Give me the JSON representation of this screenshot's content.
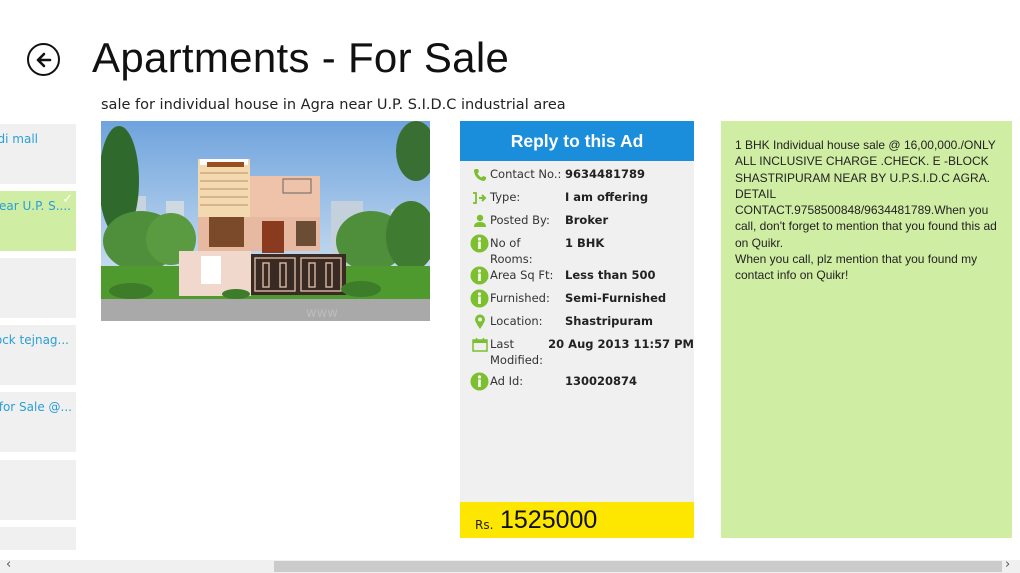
{
  "header": {
    "title": "Apartments - For Sale",
    "back_icon": "back-arrow-circle-icon"
  },
  "ad": {
    "title": "sale for individual house in Agra near U.P. S.I.D.C industrial area",
    "image_alt": "Individual house photo"
  },
  "sidebar": {
    "items": [
      {
        "label": "di mall",
        "selected": false
      },
      {
        "label": "near U.P. S....",
        "selected": true
      },
      {
        "label": "",
        "selected": false
      },
      {
        "label": "lock tejnag...",
        "selected": false
      },
      {
        "label": "t for Sale @...",
        "selected": false
      },
      {
        "label": "",
        "selected": false
      },
      {
        "label": "",
        "selected": false
      }
    ]
  },
  "info": {
    "reply_label": "Reply to this Ad",
    "rows": [
      {
        "icon": "phone-icon",
        "key": "Contact No.:",
        "value": "9634481789"
      },
      {
        "icon": "type-arrow-icon",
        "key": "Type:",
        "value": "I am offering"
      },
      {
        "icon": "person-icon",
        "key": "Posted By:",
        "value": "Broker"
      },
      {
        "icon": "info-icon",
        "key": "No of Rooms:",
        "value": "1 BHK"
      },
      {
        "icon": "info-icon",
        "key": "Area Sq Ft:",
        "value": "Less than 500"
      },
      {
        "icon": "info-icon",
        "key": "Furnished:",
        "value": "Semi-Furnished"
      },
      {
        "icon": "location-pin-icon",
        "key": "Location:",
        "value": "Shastripuram"
      },
      {
        "icon": "calendar-icon",
        "key": "Last Modified:",
        "value": "20 Aug 2013 11:57 PM"
      },
      {
        "icon": "info-icon",
        "key": "Ad Id:",
        "value": "130020874"
      }
    ],
    "price_currency": "Rs.",
    "price_value": "1525000"
  },
  "description": {
    "text": "1 BHK Individual house sale @ 16,00,000./ONLY ALL INCLUSIVE CHARGE .CHECK. E -BLOCK SHASTRIPURAM NEAR BY U.P.S.I.D.C AGRA. DETAIL CONTACT.9758500848/9634481789.When you call, don't forget to mention that you found this ad on Quikr.",
    "note": "When you call, plz mention that you found my contact info on Quikr!"
  },
  "scrollbar": {
    "left_arrow": "‹",
    "right_arrow": "›"
  },
  "colors": {
    "accent_blue": "#1a8ddb",
    "selected_green": "#d0eda4",
    "icon_green": "#7cbf2f",
    "price_yellow": "#fde600",
    "link_blue": "#2a9fd6"
  }
}
